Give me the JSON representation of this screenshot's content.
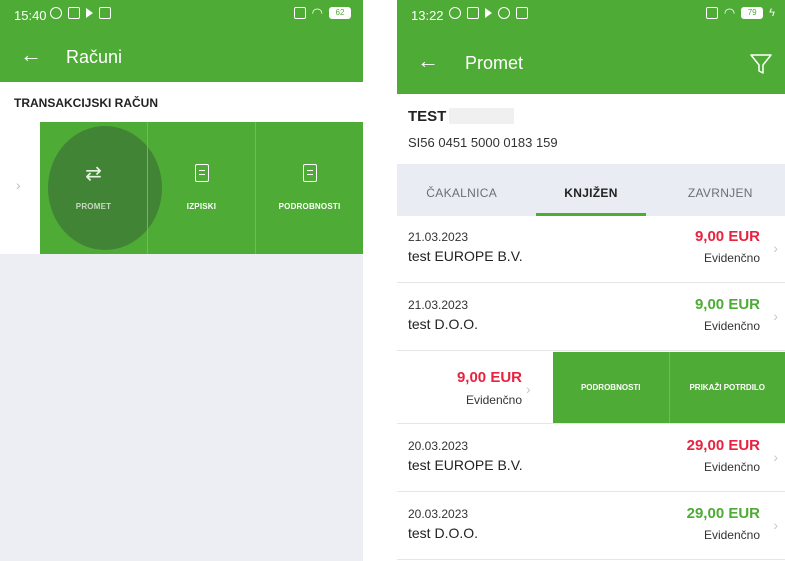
{
  "left_screen": {
    "status_bar": {
      "time": "15:40",
      "battery": "62"
    },
    "app_bar": {
      "title": "Računi"
    },
    "section_title": "TRANSAKCIJSKI RAČUN",
    "actions": [
      {
        "label": "PROMET"
      },
      {
        "label": "IZPISKI"
      },
      {
        "label": "PODROBNOSTI"
      }
    ]
  },
  "right_screen": {
    "status_bar": {
      "time": "13:22",
      "battery": "79"
    },
    "app_bar": {
      "title": "Promet"
    },
    "account": {
      "name": "TEST",
      "iban": "SI56 0451 5000 0183 159"
    },
    "tabs": [
      {
        "label": "ČAKALNICA",
        "active": false
      },
      {
        "label": "KNJIŽEN",
        "active": true
      },
      {
        "label": "ZAVRNJEN",
        "active": false
      }
    ],
    "transactions": [
      {
        "date": "21.03.2023",
        "description": "test EUROPE B.V.",
        "amount": "9,00 EUR",
        "status": "Evidenčno",
        "color": "#e8223f"
      },
      {
        "date": "21.03.2023",
        "description": "test D.O.O.",
        "amount": "9,00 EUR",
        "status": "Evidenčno",
        "color": "#4eab35"
      },
      {
        "date": "20.03.2023",
        "description": "test EUROPE B.V.",
        "amount": "29,00 EUR",
        "status": "Evidenčno",
        "color": "#e8223f"
      },
      {
        "date": "20.03.2023",
        "description": "test D.O.O.",
        "amount": "29,00 EUR",
        "status": "Evidenčno",
        "color": "#4eab35"
      }
    ],
    "swiped_row": {
      "amount": "9,00 EUR",
      "status": "Evidenčno",
      "actions": [
        {
          "label": "PODROBNOSTI"
        },
        {
          "label": "PRIKAŽI POTRDILO"
        }
      ]
    }
  },
  "colors": {
    "brand_green": "#4eab35",
    "debit_red": "#e8223f",
    "credit_green": "#4eab35"
  },
  "icons": [
    "back-arrow-icon",
    "swap-arrows-icon",
    "document-icon",
    "filter-icon",
    "chevron-right-icon"
  ]
}
